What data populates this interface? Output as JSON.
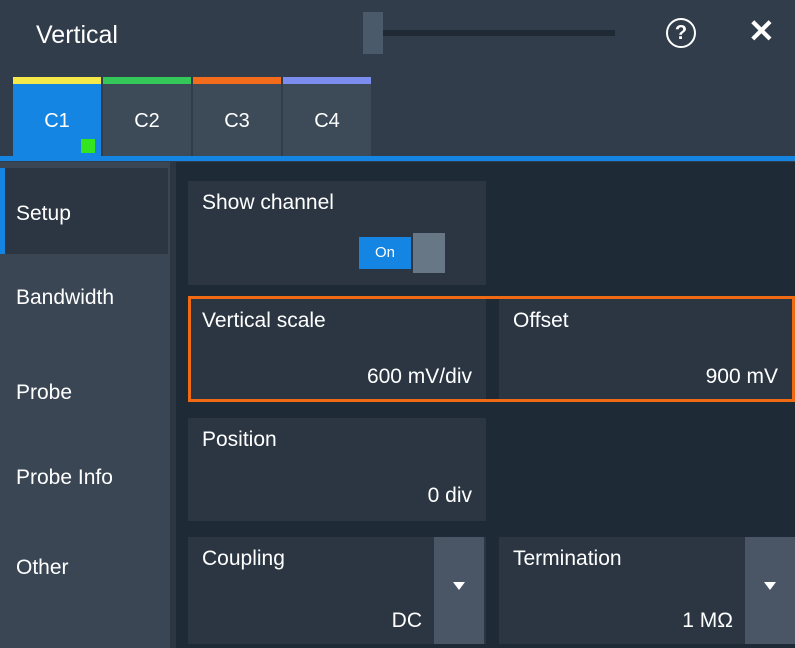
{
  "dialog": {
    "title": "Vertical",
    "help_icon": "?",
    "close_icon": "✕"
  },
  "tabs": [
    {
      "label": "C1",
      "color": "#f4e84a",
      "active": true
    },
    {
      "label": "C2",
      "color": "#34c759"
    },
    {
      "label": "C3",
      "color": "#f36c1c"
    },
    {
      "label": "C4",
      "color": "#7c8df0"
    }
  ],
  "sidebar": {
    "items": [
      {
        "label": "Setup"
      },
      {
        "label": "Bandwidth"
      },
      {
        "label": "Probe"
      },
      {
        "label": "Probe Info"
      },
      {
        "label": "Other"
      }
    ]
  },
  "setup": {
    "show_channel": {
      "label": "Show channel",
      "toggle_text": "On"
    },
    "vertical_scale": {
      "label": "Vertical scale",
      "value": "600 mV/div"
    },
    "offset": {
      "label": "Offset",
      "value": "900 mV"
    },
    "position": {
      "label": "Position",
      "value": "0 div"
    },
    "coupling": {
      "label": "Coupling",
      "value": "DC"
    },
    "termination": {
      "label": "Termination",
      "value": "1 MΩ"
    }
  },
  "colors": {
    "accent": "#1585e3",
    "highlight": "#ef6a12",
    "channel_indicator": "#34e41e"
  }
}
